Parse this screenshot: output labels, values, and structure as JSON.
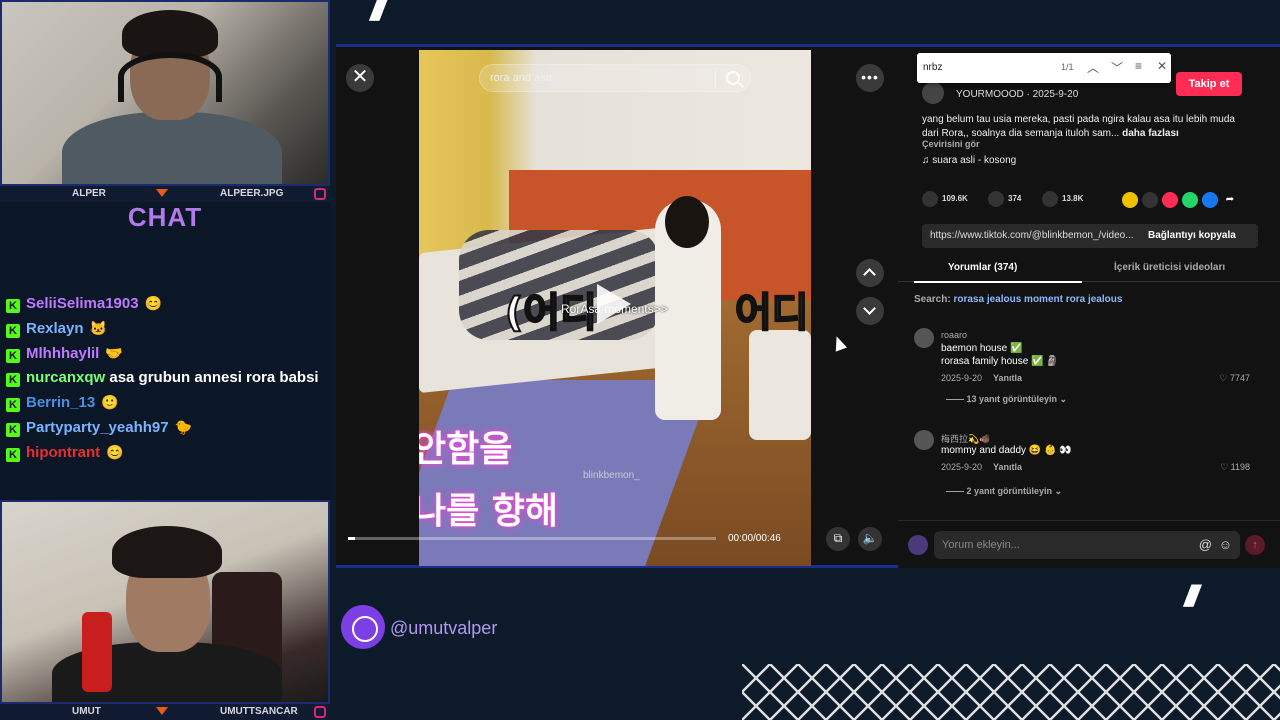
{
  "overlay": {
    "cam_top": {
      "left_name": "ALPER",
      "right_name": "ALPEER.JPG"
    },
    "cam_bottom": {
      "left_name": "UMUT",
      "right_name": "UMUTTSANCAR"
    },
    "chat_title": "CHAT",
    "chat_messages": [
      {
        "user": "SeliiSelima1903",
        "color": "#c07aff",
        "text": "",
        "emote": "emote-green"
      },
      {
        "user": "Rexlayn",
        "color": "#7ab4ff",
        "text": "",
        "emote": "emote-cat"
      },
      {
        "user": "Mlhhhaylil",
        "color": "#c07aff",
        "text": "",
        "emote": "emote-hands"
      },
      {
        "user": "nurcanxqw",
        "color": "#7aff7a",
        "text": "asa grubun annesi rora babsi",
        "emote": ""
      },
      {
        "user": "Berrin_13",
        "color": "#4a90e2",
        "text": "",
        "emote": "emote-face"
      },
      {
        "user": "Partyparty_yeahh97",
        "color": "#7ab4ff",
        "text": "",
        "emote": "emote-duck"
      },
      {
        "user": "hipontrant",
        "color": "#e83030",
        "text": "",
        "emote": "emote-green"
      }
    ],
    "social_handle": "@umutvalper",
    "colors": {
      "accent": "#7b3fe4",
      "kick_green": "#53fc18",
      "frame": "#1c2b6e"
    }
  },
  "video": {
    "search_query": "rora and asa",
    "overlay_small": "RorAsa moments>>",
    "korean_1": "(어디",
    "korean_2": "어디",
    "korean_pink_1": "안함을",
    "korean_pink_2": "나를 향해",
    "watermark": "blinkbemon_",
    "time": "00:00/00:46",
    "progress_fraction": 0.02
  },
  "panel": {
    "find": {
      "query": "nrbz",
      "count": "1/1"
    },
    "author_meta": "YOURMOOOD · 2025-9-20",
    "follow": "Takip et",
    "description": "yang belum tau usia mereka, pasti pada ngira kalau asa itu lebih muda dari Rora,, soalnya dia semanja ituloh sam...",
    "description_more": "daha fazlası",
    "translate": "Çevirisini gör",
    "music": "♫  suara asli - kosong",
    "likes": "109.6K",
    "comments": "374",
    "saves": "13.8K",
    "url": "https://www.tiktok.com/@blinkbemon_/video...",
    "copy_link": "Bağlantıyı kopyala",
    "tabs": [
      "Yorumlar (374)",
      "İçerik üreticisi videoları"
    ],
    "search_label": "Search:",
    "search_terms": "rorasa jealous moment rora jealous",
    "comments_list": [
      {
        "name": "roaaro",
        "line1": "baemon house ✅",
        "line2": "rorasa family house ✅ 🗿",
        "date": "2025-9-20",
        "reply": "Yanıtla",
        "likes": "♡ 7747",
        "view_replies": "—— 13 yanıt görüntüleyin ⌄"
      },
      {
        "name": "梅西拉💫🐗",
        "line1": "mommy and daddy 😆 👶 👀",
        "line2": "",
        "date": "2025-9-20",
        "reply": "Yanıtla",
        "likes": "♡ 1198",
        "view_replies": "—— 2 yanıt görüntüleyin ⌄"
      }
    ],
    "compose_placeholder": "Yorum ekleyin...",
    "colors": {
      "follow": "#fe2c55",
      "link": "#8fb7ff"
    }
  }
}
